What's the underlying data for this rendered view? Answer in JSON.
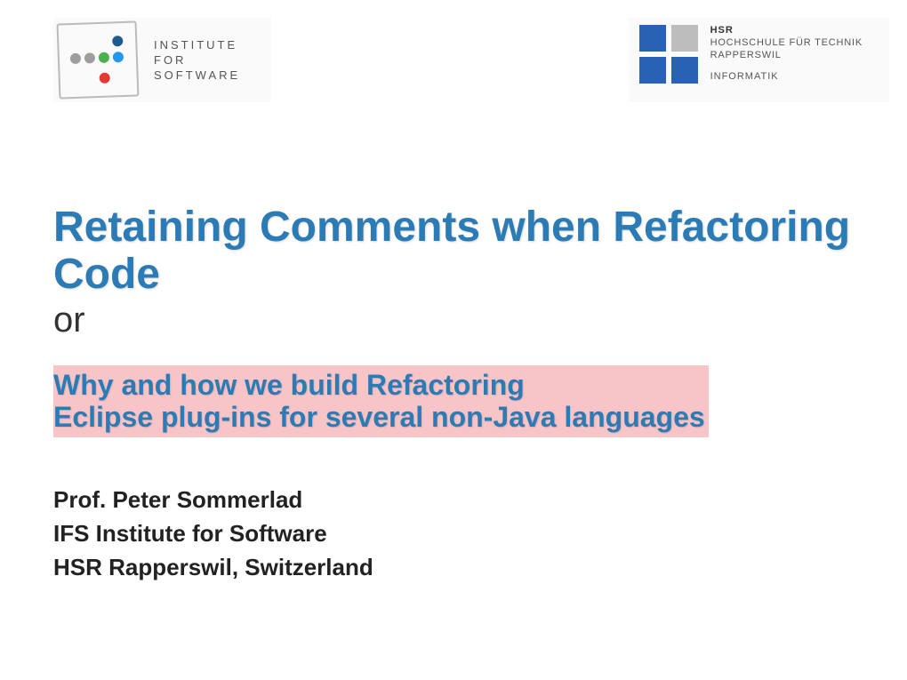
{
  "header": {
    "left_logo": {
      "line1": "INSTITUTE",
      "line2": "FOR",
      "line3": "SOFTWARE"
    },
    "right_logo": {
      "line1": "HSR",
      "line2": "HOCHSCHULE FÜR TECHNIK",
      "line3": "RAPPERSWIL",
      "line4": "INFORMATIK"
    }
  },
  "content": {
    "title": "Retaining Comments when Refactoring Code",
    "conjunction": "or",
    "subtitle_line1": "Why and how we build Refactoring",
    "subtitle_line2": "Eclipse plug-ins for several non-Java languages",
    "author": "Prof. Peter Sommerlad",
    "affiliation1": "IFS Institute for Software",
    "affiliation2": "HSR Rapperswil, Switzerland"
  }
}
